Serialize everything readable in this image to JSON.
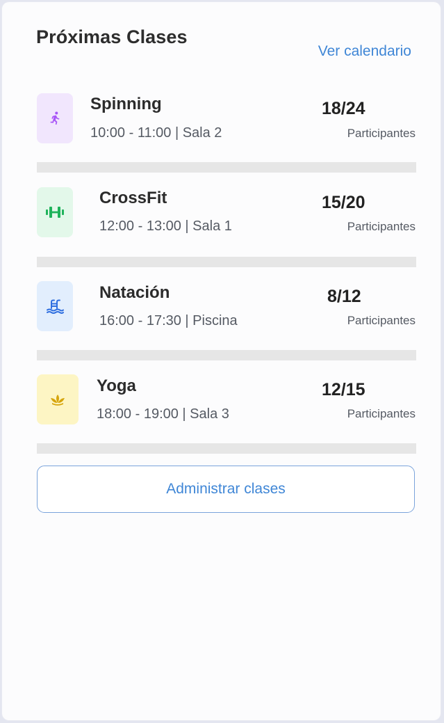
{
  "header": {
    "title": "Próximas Clases",
    "calendar_link": "Ver calendario"
  },
  "classes": [
    {
      "name": "Spinning",
      "schedule": "10:00 - 11:00 | Sala 2",
      "count": "18/24",
      "count_label": "Participantes",
      "icon": "running-person-icon",
      "icon_color": "#a855f7",
      "icon_bg": "#f1e6fd"
    },
    {
      "name": "CrossFit",
      "schedule": "12:00 - 13:00 | Sala 1",
      "count": "15/20",
      "count_label": "Participantes",
      "icon": "dumbbell-icon",
      "icon_color": "#1fb35b",
      "icon_bg": "#e3f8ea"
    },
    {
      "name": "Natación",
      "schedule": "16:00 - 17:30 | Piscina",
      "count": "8/12",
      "count_label": "Participantes",
      "icon": "pool-icon",
      "icon_color": "#2f6fe0",
      "icon_bg": "#e2eefd"
    },
    {
      "name": "Yoga",
      "schedule": "18:00 - 19:00 | Sala 3",
      "count": "12/15",
      "count_label": "Participantes",
      "icon": "lotus-icon",
      "icon_color": "#d6a50c",
      "icon_bg": "#fdf5c4"
    }
  ],
  "footer": {
    "manage_button": "Administrar clases"
  }
}
